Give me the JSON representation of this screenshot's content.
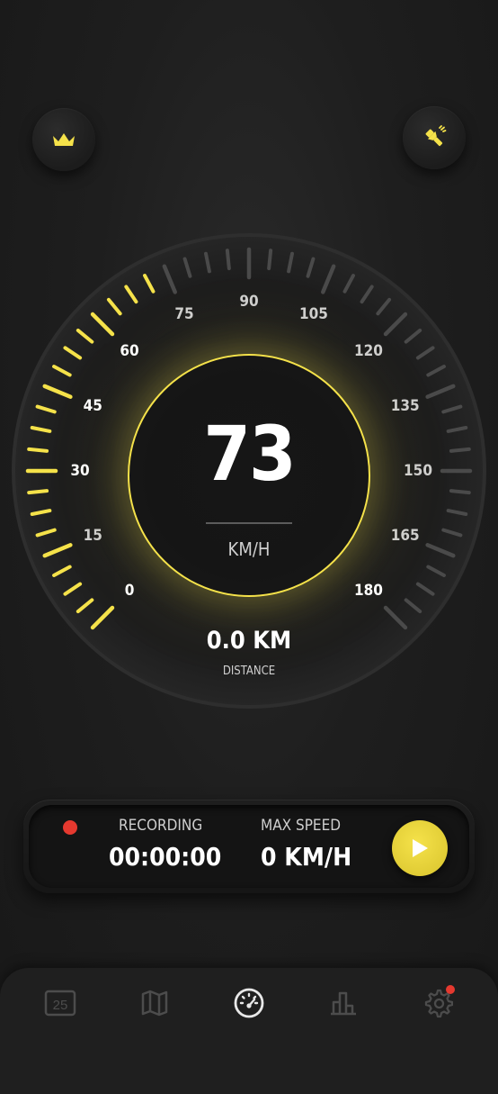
{
  "header": {
    "premium_icon": "crown-icon",
    "flashlight_icon": "flashlight-icon"
  },
  "gauge": {
    "speed": "73",
    "unit": "KM/H",
    "speed_value": 73,
    "max_scale": 180,
    "scale_labels": [
      "0",
      "15",
      "30",
      "45",
      "60",
      "75",
      "90",
      "105",
      "120",
      "135",
      "150",
      "165",
      "180"
    ],
    "active_color": "#f5e24a",
    "inactive_color": "#4a4a4a"
  },
  "distance": {
    "value": "0.0 KM",
    "label": "DISTANCE"
  },
  "recording": {
    "status_color": "#e5392f",
    "label": "RECORDING",
    "time": "00:00:00",
    "max_speed_label": "MAX SPEED",
    "max_speed_value": "0 KM/H",
    "play_icon": "play-icon"
  },
  "nav": {
    "calendar_day": "25",
    "items": [
      "calendar-icon",
      "map-icon",
      "speedometer-icon",
      "stats-icon",
      "settings-icon"
    ],
    "badge_color": "#e5392f"
  }
}
